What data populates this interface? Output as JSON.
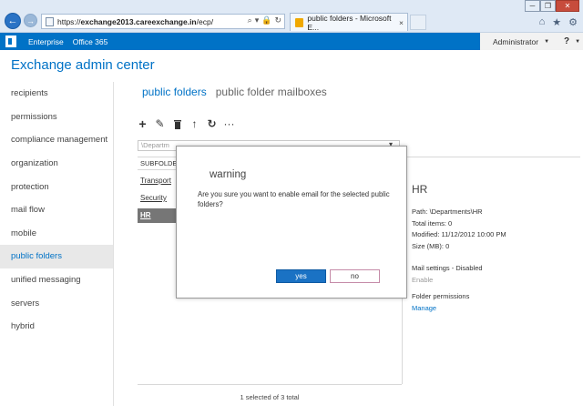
{
  "browser": {
    "url_prefix": "https://",
    "url_host": "exchange2013.careexchange.in",
    "url_path": "/ecp/",
    "tab_title": "public folders - Microsoft E...",
    "tab_close": "×",
    "controls": {
      "minimize": "─",
      "restore": "❐",
      "close": "✕"
    }
  },
  "o365": {
    "links": [
      "Enterprise",
      "Office 365"
    ],
    "user": "Administrator",
    "help": "?"
  },
  "app": {
    "title": "Exchange admin center"
  },
  "left_nav": [
    {
      "label": "recipients",
      "active": false
    },
    {
      "label": "permissions",
      "active": false
    },
    {
      "label": "compliance management",
      "active": false
    },
    {
      "label": "organization",
      "active": false
    },
    {
      "label": "protection",
      "active": false
    },
    {
      "label": "mail flow",
      "active": false
    },
    {
      "label": "mobile",
      "active": false
    },
    {
      "label": "public folders",
      "active": true
    },
    {
      "label": "unified messaging",
      "active": false
    },
    {
      "label": "servers",
      "active": false
    },
    {
      "label": "hybrid",
      "active": false
    }
  ],
  "sub_tabs": [
    {
      "label": "public folders",
      "active": true
    },
    {
      "label": "public folder mailboxes",
      "active": false
    }
  ],
  "toolbar_icons": [
    "add-icon",
    "edit-icon",
    "delete-icon",
    "move-up-icon",
    "refresh-icon",
    "more-icon"
  ],
  "path_box": {
    "value": "\\Departm"
  },
  "list": {
    "header": "SUBFOLDER",
    "items": [
      "Transport",
      "Security",
      "HR"
    ],
    "selected_index": 2,
    "status": "1 selected of 3 total"
  },
  "details": {
    "title": "HR",
    "path": "Path: \\Departments\\HR",
    "total_items": "Total items: 0",
    "modified": "Modified: 11/12/2012 10:00 PM",
    "size": "Size (MB): 0",
    "mail_settings": "Mail settings - Disabled",
    "enable_link": "Enable",
    "folder_permissions": "Folder permissions",
    "manage_link": "Manage"
  },
  "dialog": {
    "title": "warning",
    "message": "Are you sure you want to enable email for the selected public folders?",
    "yes_label": "yes",
    "no_label": "no"
  },
  "colors": {
    "accent": "#0072c6",
    "selected_row": "#767676",
    "primary_button": "#1a72c4"
  }
}
